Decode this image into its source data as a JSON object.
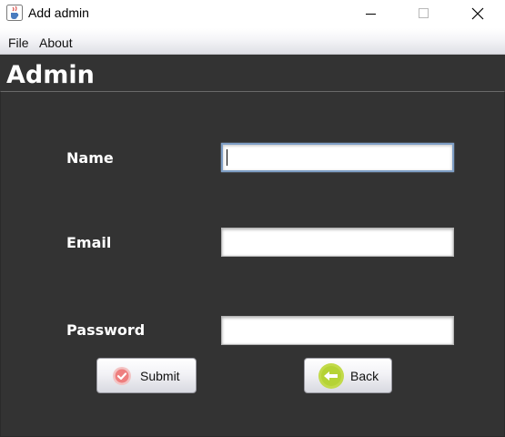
{
  "window": {
    "title": "Add admin",
    "app_icon": "java-cup-icon"
  },
  "menubar": {
    "items": [
      {
        "label": "File"
      },
      {
        "label": "About"
      }
    ]
  },
  "form": {
    "heading": "Admin",
    "fields": {
      "name": {
        "label": "Name",
        "value": ""
      },
      "email": {
        "label": "Email",
        "value": ""
      },
      "password": {
        "label": "Password",
        "value": ""
      }
    },
    "buttons": {
      "submit": {
        "label": "Submit",
        "icon": "check-circle-icon"
      },
      "back": {
        "label": "Back",
        "icon": "back-arrow-icon"
      }
    }
  },
  "colors": {
    "panel_bg": "#333333",
    "focus_border": "#7f9fc6",
    "submit_icon": "#f08080",
    "back_icon": "#b5d335"
  }
}
